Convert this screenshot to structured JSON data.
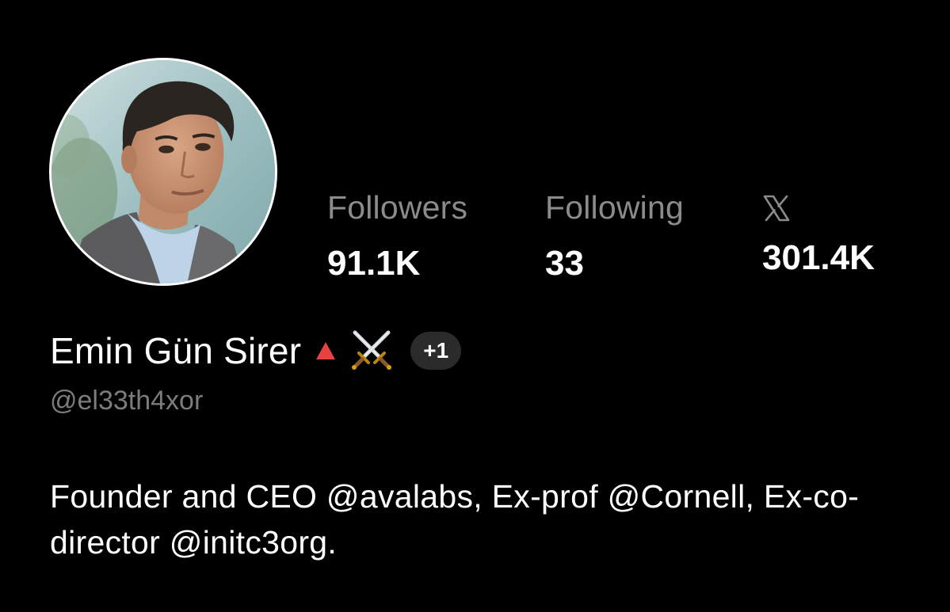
{
  "profile": {
    "display_name": "Emin Gün Sirer",
    "handle": "@el33th4xor",
    "badge_icons": [
      "red-triangle-icon",
      "crossed-swords-icon"
    ],
    "extra_badges": "+1",
    "bio": "Founder and CEO @avalabs, Ex-prof @Cornell, Ex-co-director @initc3org.",
    "avatar": "avatar-photo"
  },
  "stats": {
    "followers": {
      "label": "Followers",
      "value": "91.1K"
    },
    "following": {
      "label": "Following",
      "value": "33"
    },
    "x": {
      "icon": "x-logo-icon",
      "value": "301.4K"
    }
  },
  "colors": {
    "background": "#000000",
    "text": "#ffffff",
    "muted": "#8b8b8b",
    "pill": "#2b2b2b",
    "badge_red": "#e84142"
  }
}
